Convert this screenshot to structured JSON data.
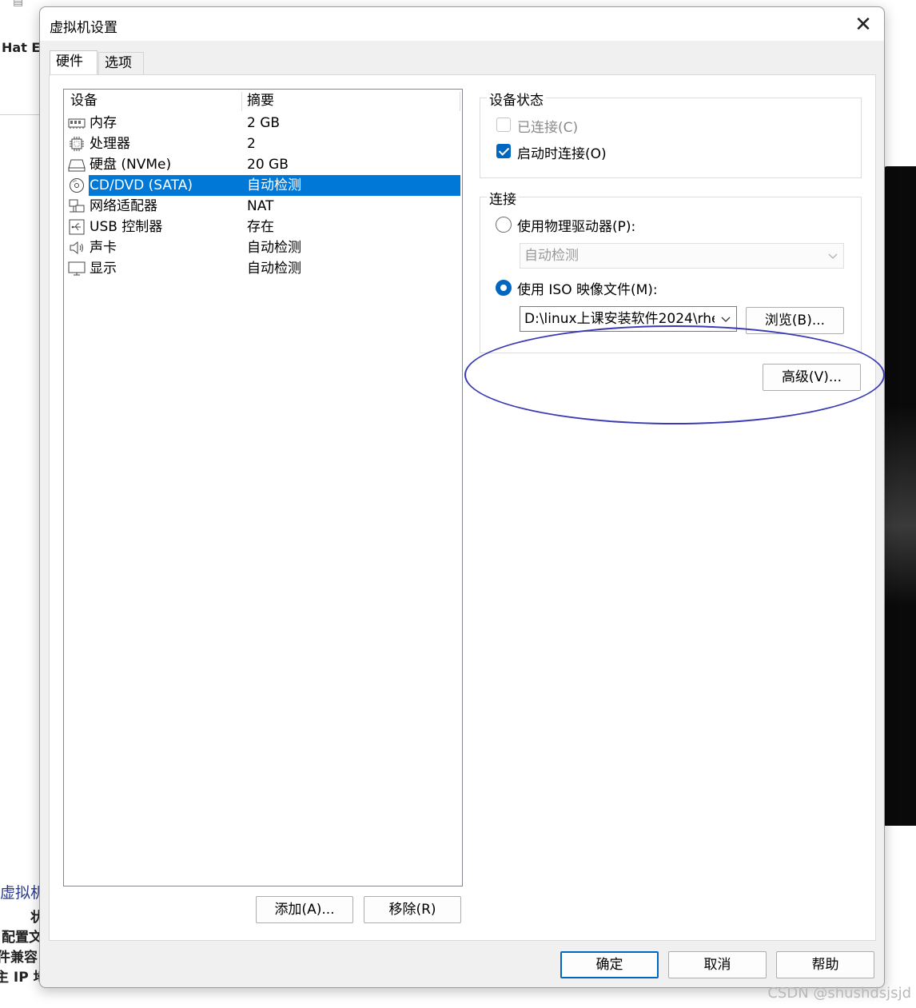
{
  "background": {
    "title_fragment": "Hat E",
    "link_fragment": "虚拟机",
    "labels": [
      "状",
      "配置文",
      "件兼容",
      "主 IP 地"
    ]
  },
  "dialog": {
    "title": "虚拟机设置",
    "close_symbol": "✕",
    "tabs": [
      {
        "label": "硬件",
        "active": true
      },
      {
        "label": "选项",
        "active": false
      }
    ],
    "device_list": {
      "headers": {
        "device": "设备",
        "summary": "摘要"
      },
      "rows": [
        {
          "name": "内存",
          "summary": "2 GB",
          "icon": "memory-icon",
          "selected": false
        },
        {
          "name": "处理器",
          "summary": "2",
          "icon": "processor-icon",
          "selected": false
        },
        {
          "name": "硬盘 (NVMe)",
          "summary": "20 GB",
          "icon": "hard-disk-icon",
          "selected": false
        },
        {
          "name": "CD/DVD (SATA)",
          "summary": "自动检测",
          "icon": "cd-dvd-icon",
          "selected": true
        },
        {
          "name": "网络适配器",
          "summary": "NAT",
          "icon": "network-adapter-icon",
          "selected": false
        },
        {
          "name": "USB 控制器",
          "summary": "存在",
          "icon": "usb-icon",
          "selected": false
        },
        {
          "name": "声卡",
          "summary": "自动检测",
          "icon": "speaker-icon",
          "selected": false
        },
        {
          "name": "显示",
          "summary": "自动检测",
          "icon": "display-icon",
          "selected": false
        }
      ]
    },
    "add_button": "添加(A)...",
    "remove_button": "移除(R)",
    "device_status": {
      "title": "设备状态",
      "connected": {
        "label": "已连接(C)",
        "checked": false,
        "disabled": true
      },
      "connect_at_power_on": {
        "label": "启动时连接(O)",
        "checked": true
      }
    },
    "connection": {
      "title": "连接",
      "physical_drive": {
        "label": "使用物理驱动器(P):",
        "selected": false
      },
      "physical_drive_select": "自动检测",
      "iso_image": {
        "label": "使用 ISO 映像文件(M):",
        "selected": true
      },
      "iso_path": "D:\\linux上课安装软件2024\\rhe",
      "browse_button": "浏览(B)..."
    },
    "advanced_button": "高级(V)...",
    "ok_button": "确定",
    "cancel_button": "取消",
    "help_button": "帮助",
    "colors": {
      "accent": "#0078d7",
      "annotation": "#3a3ab5"
    }
  },
  "watermark": "CSDN @shushdsjsjd"
}
